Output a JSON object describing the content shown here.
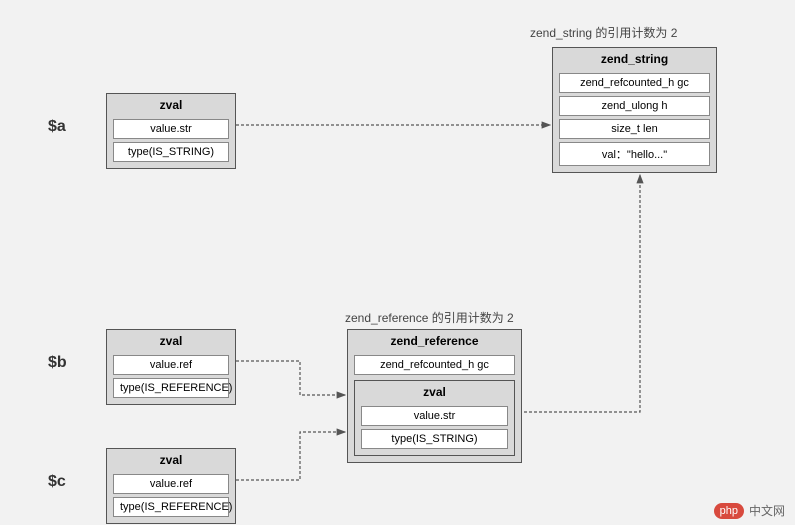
{
  "labels": {
    "a": "$a",
    "b": "$b",
    "c": "$c"
  },
  "annotations": {
    "zend_string_ref": "zend_string 的引用计数为 2",
    "zend_reference_ref": "zend_reference 的引用计数为 2"
  },
  "boxes": {
    "zval_a": {
      "title": "zval",
      "row1": "value.str",
      "row2": "type(IS_STRING)"
    },
    "zval_b": {
      "title": "zval",
      "row1": "value.ref",
      "row2": "type(IS_REFERENCE)"
    },
    "zval_c": {
      "title": "zval",
      "row1": "value.ref",
      "row2": "type(IS_REFERENCE)"
    },
    "zend_string": {
      "title": "zend_string",
      "row1": "zend_refcounted_h gc",
      "row2": "zend_ulong        h",
      "row3": "size_t           len",
      "row4": "val：\"hello...\""
    },
    "zend_reference": {
      "title": "zend_reference",
      "row1": "zend_refcounted_h gc",
      "inner": {
        "title": "zval",
        "row1": "value.str",
        "row2": "type(IS_STRING)"
      }
    }
  },
  "watermark": {
    "logo": "php",
    "text": "中文网"
  }
}
